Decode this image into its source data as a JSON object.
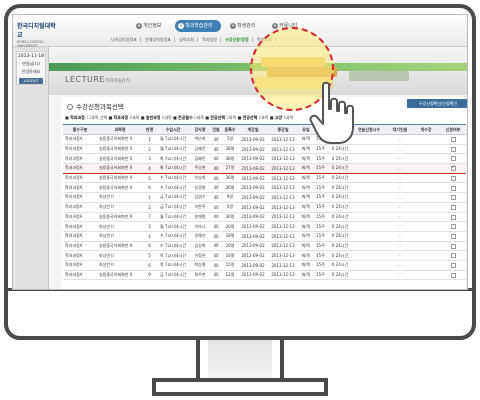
{
  "school": {
    "name": "한국디지털대학교",
    "sub": "KOREA DIGITAL UNIVERSITY"
  },
  "nav": [
    {
      "label": "개인정보",
      "active": false
    },
    {
      "label": "학과학습관리",
      "active": true
    },
    {
      "label": "학생관리",
      "active": false
    },
    {
      "label": "커뮤니티",
      "active": false
    }
  ],
  "submenu": [
    {
      "label": "나의강의일정표",
      "hl": false
    },
    {
      "label": "전체강의일정표",
      "hl": false
    },
    {
      "label": "성적조회",
      "hl": false
    },
    {
      "label": "학과일정",
      "hl": false
    },
    {
      "label": "수강신청/정정",
      "hl": true
    },
    {
      "label": "학과공지",
      "hl": false
    }
  ],
  "user": {
    "date": "2013-11-18",
    "name": "연길님(디)",
    "greeting": "안녕하세요",
    "button": "LOGOUT"
  },
  "banner": {
    "title": "LECTURE",
    "subtitle": "학과학습관리"
  },
  "content": {
    "title": "수강신청과목선택",
    "button": "수강신청확인/신청확인"
  },
  "filters": {
    "f1_label": "학과과정",
    "f1_count": "13",
    "f2_label": "학과과정",
    "f2_count": "8",
    "f3_label": "일반과정",
    "f3_count": "0",
    "f4_label": "전공필수",
    "f4_count": "0",
    "f5_label": "전공선택",
    "f5_count": "0",
    "f6_label": "전공선택",
    "f6_count": "0",
    "f7_label": "교양",
    "f7_count": "0"
  },
  "table": {
    "headers": [
      "필수구분",
      "과목명",
      "반명",
      "수업시간",
      "강사명",
      "인원",
      "등록수",
      "개강일",
      "종강일",
      "요일",
      "시수",
      "시간",
      "연습신청시수",
      "대기인원",
      "개수강",
      "신청여부"
    ],
    "rows": [
      {
        "c1": "학과과정A",
        "c2": "실용중국어회화반 II",
        "c3": "1",
        "c4": "월 7교시/4시간",
        "c5": "박난희",
        "c6": "40",
        "c7": "1명",
        "c8": "2013-09-02",
        "c9": "2013-12-13",
        "c10": "화/목",
        "c11": "15주",
        "c12": "0 24시간",
        "c13": "",
        "c14": "-",
        "c15": "",
        "checked": false
      },
      {
        "c1": "학과과정A",
        "c2": "실용중국어회화반 II",
        "c3": "2",
        "c4": "월 7교시/4시간",
        "c5": "김혜진",
        "c6": "40",
        "c7": "38명",
        "c8": "2013-09-02",
        "c9": "2013-12-13",
        "c10": "화/목",
        "c11": "15주",
        "c12": "0 24시간",
        "c13": "",
        "c14": "-",
        "c15": "",
        "checked": false
      },
      {
        "c1": "학과과정A",
        "c2": "실용중국어회화반 II",
        "c3": "3",
        "c4": "화 7교시/4시간",
        "c5": "김혜진",
        "c6": "40",
        "c7": "38명",
        "c8": "2013-09-02",
        "c9": "2013-12-13",
        "c10": "화/목",
        "c11": "15주",
        "c12": "0 24시간",
        "c13": "",
        "c14": "-",
        "c15": "",
        "checked": false
      },
      {
        "c1": "학과과정A",
        "c2": "실용중국어회화반 II",
        "c3": "4",
        "c4": "화 7교시/4시간",
        "c5": "주상현",
        "c6": "40",
        "c7": "27명",
        "c8": "2013-09-02",
        "c9": "2013-12-13",
        "c10": "화/목",
        "c11": "15주",
        "c12": "0 24시간",
        "c13": "",
        "c14": "-",
        "c15": "",
        "checked": true,
        "selected": true
      },
      {
        "c1": "학과과정A",
        "c2": "실용중국어회화반 II",
        "c3": "5",
        "c4": "수 7교시/4시간",
        "c5": "이상희",
        "c6": "40",
        "c7": "36명",
        "c8": "2013-09-02",
        "c9": "2013-12-13",
        "c10": "화/목",
        "c11": "15주",
        "c12": "0 24시간",
        "c13": "",
        "c14": "-",
        "c15": "",
        "checked": false
      },
      {
        "c1": "학과과정A",
        "c2": "실용중국어회화반 II",
        "c3": "6",
        "c4": "수 7교시/4시간",
        "c5": "신경원",
        "c6": "40",
        "c7": "36명",
        "c8": "2013-09-02",
        "c9": "2013-12-13",
        "c10": "화/목",
        "c11": "15주",
        "c12": "0 24시간",
        "c13": "",
        "c14": "-",
        "c15": "",
        "checked": false
      },
      {
        "c1": "학과과정A",
        "c2": "하상반 II",
        "c3": "1",
        "c4": "금 7교시/4시간",
        "c5": "김영수",
        "c6": "40",
        "c7": "9명",
        "c8": "2013-09-02",
        "c9": "2013-12-13",
        "c10": "화/목",
        "c11": "15주",
        "c12": "0 24시간",
        "c13": "",
        "c14": "-",
        "c15": "",
        "checked": false
      },
      {
        "c1": "학과과정A",
        "c2": "하상반 II",
        "c3": "2",
        "c4": "금 7교시/4시간",
        "c5": "이한주",
        "c6": "40",
        "c7": "5명",
        "c8": "2013-09-02",
        "c9": "2013-12-13",
        "c10": "화/목",
        "c11": "15주",
        "c12": "0 24시간",
        "c13": "",
        "c14": "-",
        "c15": "",
        "checked": false
      },
      {
        "c1": "학과과정A",
        "c2": "실용중국어회화반 II",
        "c3": "7",
        "c4": "월 7교시/4시간",
        "c5": "한해원",
        "c6": "40",
        "c7": "30명",
        "c8": "2013-09-02",
        "c9": "2013-12-13",
        "c10": "화/목",
        "c11": "15주",
        "c12": "0 24시간",
        "c13": "",
        "c14": "-",
        "c15": "",
        "checked": false
      },
      {
        "c1": "학과과정A",
        "c2": "하상반 II",
        "c3": "3",
        "c4": "월 7교시/4시간",
        "c5": "이하나",
        "c6": "40",
        "c7": "20명",
        "c8": "2013-09-02",
        "c9": "2013-12-13",
        "c10": "화/목",
        "c11": "15주",
        "c12": "0 24시간",
        "c13": "",
        "c14": "-",
        "c15": "",
        "checked": false
      },
      {
        "c1": "학과과정A",
        "c2": "하상반 II",
        "c3": "4",
        "c4": "수 7교시/4시간",
        "c5": "권해선",
        "c6": "40",
        "c7": "18명",
        "c8": "2013-09-02",
        "c9": "2013-12-13",
        "c10": "화/목",
        "c11": "15주",
        "c12": "0 24시간",
        "c13": "",
        "c14": "-",
        "c15": "",
        "checked": false
      },
      {
        "c1": "학과과정A",
        "c2": "실용중국어회화반 II",
        "c3": "8",
        "c4": "수 7교시/4시간",
        "c5": "김성희",
        "c6": "40",
        "c7": "20명",
        "c8": "2013-09-02",
        "c9": "2013-12-13",
        "c10": "화/목",
        "c11": "15주",
        "c12": "0 24시간",
        "c13": "",
        "c14": "-",
        "c15": "",
        "checked": false
      },
      {
        "c1": "학과과정A",
        "c2": "하상반 II",
        "c3": "5",
        "c4": "목 7교시/4시간",
        "c5": "이정은",
        "c6": "40",
        "c7": "16명",
        "c8": "2013-09-02",
        "c9": "2013-12-13",
        "c10": "화/목",
        "c11": "15주",
        "c12": "0 24시간",
        "c13": "",
        "c14": "-",
        "c15": "",
        "checked": false
      },
      {
        "c1": "학과과정A",
        "c2": "하상반 II",
        "c3": "6",
        "c4": "목 7교시/4시간",
        "c5": "박상철",
        "c6": "40",
        "c7": "15명",
        "c8": "2013-09-02",
        "c9": "2013-12-13",
        "c10": "화/목",
        "c11": "15주",
        "c12": "0 24시간",
        "c13": "",
        "c14": "-",
        "c15": "",
        "checked": false
      },
      {
        "c1": "학과과정A",
        "c2": "실용중국어회화반 II",
        "c3": "9",
        "c4": "금 7교시/4시간",
        "c5": "최주현",
        "c6": "40",
        "c7": "12명",
        "c8": "2013-09-02",
        "c9": "2013-12-13",
        "c10": "화/목",
        "c11": "15주",
        "c12": "0 24시간",
        "c13": "",
        "c14": "-",
        "c15": "",
        "checked": false
      }
    ]
  },
  "colors": {
    "accent": "#3f7fb3",
    "selection": "#c62b2b",
    "spotlight": "#d9232e"
  }
}
